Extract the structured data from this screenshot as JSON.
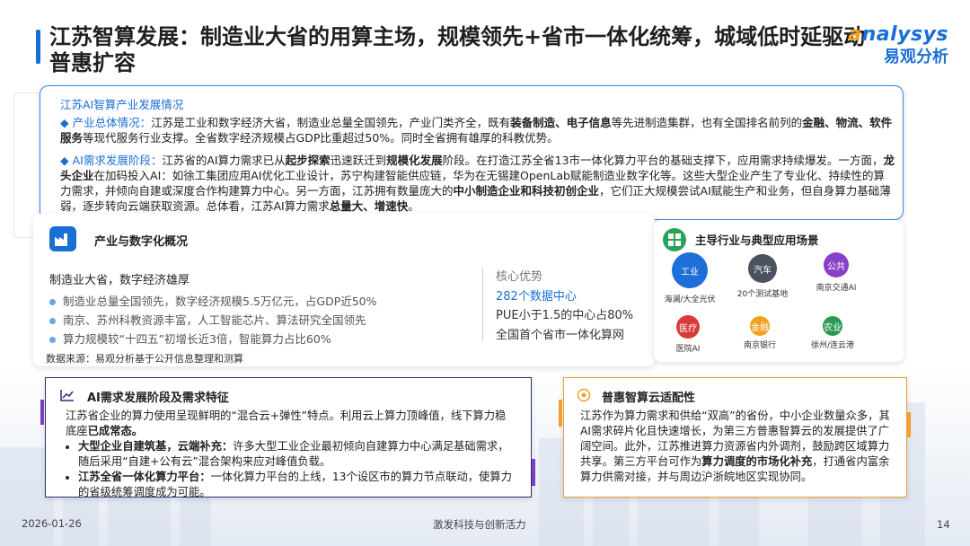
{
  "header": {
    "title": "江苏智算发展：制造业大省的用算主场，规模领先+省市一体化统筹，城域低时延驱动普惠扩容",
    "logo_en": "nalysys",
    "logo_cn": "易观分析"
  },
  "overview": {
    "heading": "江苏AI智算产业发展情况",
    "p1_label": "◆ 产业总体情况：",
    "p1_text_a": "江苏是工业和数字经济大省，制造业总量全国领先，产业门类齐全，既有",
    "p1_kw1": "装备制造、电子信息",
    "p1_text_b": "等先进制造集群，也有全国排名前列的",
    "p1_kw2": "金融、物流、软件服务",
    "p1_text_c": "等现代服务行业支撑。全省数字经济规模占GDP比重超过50%。同时全省拥有雄厚的科教优势。",
    "p2_label": "◆ AI需求发展阶段：",
    "p2_text_a": "江苏省的AI算力需求已从",
    "p2_kw1": "起步探索",
    "p2_text_b": "迅速跃迁到",
    "p2_kw2": "规模化发展",
    "p2_text_c": "阶段。在打造江苏全省13市一体化算力平台的基础支撑下，应用需求持续爆发。一方面，",
    "p2_kw3": "龙头企业",
    "p2_text_d": "在加码投入AI：如徐工集团应用AI优化工业设计，苏宁构建智能供应链，华为在无锡建OpenLab赋能制造业数字化等。这些大型企业产生了专业化、持续性的算力需求，并倾向自建或深度合作构建算力中心。另一方面，江苏拥有数量庞大的",
    "p2_kw4": "中小制造企业和科技初创企业",
    "p2_text_e": "，它们正大规模尝试AI赋能生产和业务，但自身算力基础薄弱，逐步转向云端获取资源。总体看，江苏AI算力需求",
    "p2_kw5": "总量大、增速快",
    "p2_text_f": "。"
  },
  "industry": {
    "title": "产业与数字化概况",
    "headline": "制造业大省，数字经济雄厚",
    "bullets": [
      "制造业总量全国领先，数字经济规模5.5万亿元，占GDP近50%",
      "南京、苏州科教资源丰富，人工智能芯片、算法研究全国领先",
      "算力规模较“十四五”初增长近3倍，智能算力占比60%"
    ],
    "core_title": "核心优势",
    "core_items": [
      "282个数据中心",
      "PUE小于1.5的中心占80%",
      "全国首个省市一体化算网"
    ],
    "source": "数据来源：易观分析基于公开信息整理和测算"
  },
  "scenes": {
    "title": "主导行业与典型应用场景",
    "items": [
      {
        "tag": "工业",
        "label": "海澜/大全光伏",
        "color": "#1f6fd8"
      },
      {
        "tag": "汽车",
        "label": "20个测试基地",
        "color": "#4a5260"
      },
      {
        "tag": "公共",
        "label": "南京交通AI",
        "color": "#8a3fc8"
      },
      {
        "tag": "医疗",
        "label": "医院AI",
        "color": "#d93a3a"
      },
      {
        "tag": "金融",
        "label": "南京银行",
        "color": "#f2a020"
      },
      {
        "tag": "农业",
        "label": "徐州/连云港",
        "color": "#2a9a52"
      }
    ]
  },
  "demand": {
    "title": "AI需求发展阶段及需求特征",
    "intro_a": "江苏省企业的算力使用呈现鲜明的“混合云+弹性”特点。利用云上算力顶峰值，线下算力稳底座",
    "intro_bold": "已成常态。",
    "b1_bold": "大型企业自建筑基，云端补充：",
    "b1_text": "许多大型工业企业最初倾向自建算力中心满足基础需求，随后采用“自建+公有云”混合架构来应对峰值负载。",
    "b2_bold": "江苏全省一体化算力平台：",
    "b2_text": "一体化算力平台的上线，13个设区市的算力节点联动，使算力的省级统筹调度成为可能。"
  },
  "cloud": {
    "title": "普惠智算云适配性",
    "text_a": "江苏作为算力需求和供给“双高”的省份，中小企业数量众多，其AI需求碎片化且快速增长，为第三方普惠智算云的发展提供了广阔空间。此外，江苏推进算力资源省内外调剂，鼓励跨区域算力共享。第三方平台可作为",
    "text_bold": "算力调度的市场化补充",
    "text_b": "，打通省内富余算力供需对接，并与周边沪浙皖地区实现协同。"
  },
  "footer": {
    "date": "2026-01-26",
    "slogan": "激发科技与创新活力",
    "page": "14"
  },
  "colors": {
    "accent_blue": "#1a6fd6",
    "purple": "#7a3fc2",
    "orange": "#f0a030",
    "navy": "#2b2f73"
  }
}
